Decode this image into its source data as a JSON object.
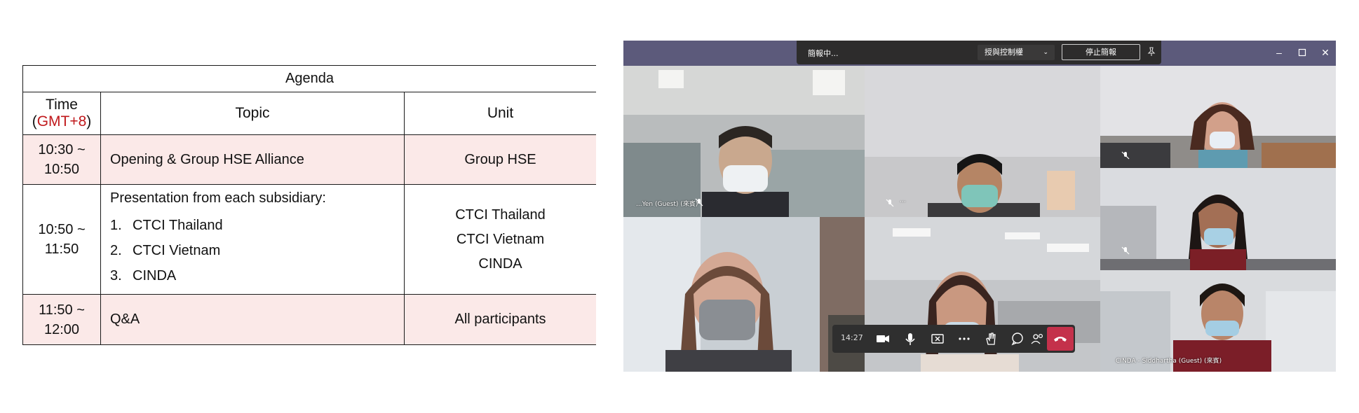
{
  "agenda": {
    "title": "Agenda",
    "header": {
      "time": "Time",
      "time_zone": "GMT+8",
      "topic": "Topic",
      "unit": "Unit"
    },
    "rows": [
      {
        "time_start": "10:30 ~",
        "time_end": "10:50",
        "topic": "Opening & Group HSE Alliance",
        "unit": "Group HSE"
      },
      {
        "time_start": "10:50 ~",
        "time_end": "11:50",
        "topic_intro": "Presentation from each subsidiary:",
        "items": [
          {
            "num": "1.",
            "label": "CTCI Thailand"
          },
          {
            "num": "2.",
            "label": "CTCI Vietnam"
          },
          {
            "num": "3.",
            "label": "CINDA"
          }
        ],
        "units": [
          "CTCI Thailand",
          "CTCI Vietnam",
          "CINDA"
        ]
      },
      {
        "time_start": "11:50 ~",
        "time_end": "12:00",
        "topic": "Q&A",
        "unit": "All participants"
      }
    ],
    "colors": {
      "time_zone": "#c0181b",
      "shade": "#fbe9e8"
    }
  },
  "teams": {
    "share_bar": {
      "status": "簡報中...",
      "give_control": "授與控制權",
      "stop_share": "停止簡報"
    },
    "tiles": [
      {
        "name": "...Yen (Guest) (來賓)"
      },
      {
        "name": ""
      },
      {
        "name": ""
      },
      {
        "name": ""
      },
      {
        "name": ""
      },
      {
        "name": ""
      },
      {
        "name": "CINDA - Siddhartha (Guest) (來賓)"
      }
    ],
    "controls": {
      "timer": "14:27"
    },
    "colors": {
      "titlebar": "#5c5a7b",
      "hangup": "#c4314b"
    }
  }
}
